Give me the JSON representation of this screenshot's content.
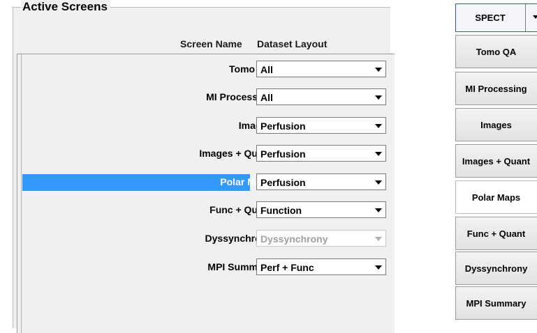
{
  "group": {
    "title": "Active Screens",
    "col_screen_name": "Screen Name",
    "col_dataset_layout": "Dataset Layout"
  },
  "rows": [
    {
      "screen": "Tomo QA",
      "layout": "All",
      "selected": false,
      "disabled": false
    },
    {
      "screen": "MI Processing",
      "layout": "All",
      "selected": false,
      "disabled": false
    },
    {
      "screen": "Images",
      "layout": "Perfusion",
      "selected": false,
      "disabled": false
    },
    {
      "screen": "Images + Quant",
      "layout": "Perfusion",
      "selected": false,
      "disabled": false
    },
    {
      "screen": "Polar Maps",
      "layout": "Perfusion",
      "selected": true,
      "disabled": false
    },
    {
      "screen": "Func + Quant",
      "layout": "Function",
      "selected": false,
      "disabled": false
    },
    {
      "screen": "Dyssynchrony",
      "layout": "Dyssynchrony",
      "selected": false,
      "disabled": true
    },
    {
      "screen": "MPI Summary",
      "layout": "Perf + Func",
      "selected": false,
      "disabled": false
    }
  ],
  "sidebar": {
    "modality": "SPECT",
    "buttons": [
      {
        "label": "Tomo QA",
        "active": false
      },
      {
        "label": "MI Processing",
        "active": false
      },
      {
        "label": "Images",
        "active": false
      },
      {
        "label": "Images + Quant",
        "active": false
      },
      {
        "label": "Polar Maps",
        "active": true
      },
      {
        "label": "Func + Quant",
        "active": false
      },
      {
        "label": "Dyssynchrony",
        "active": false
      },
      {
        "label": "MPI Summary",
        "active": false
      }
    ]
  },
  "colors": {
    "selection": "#3399ff",
    "modality_border": "#2d5ab8"
  }
}
